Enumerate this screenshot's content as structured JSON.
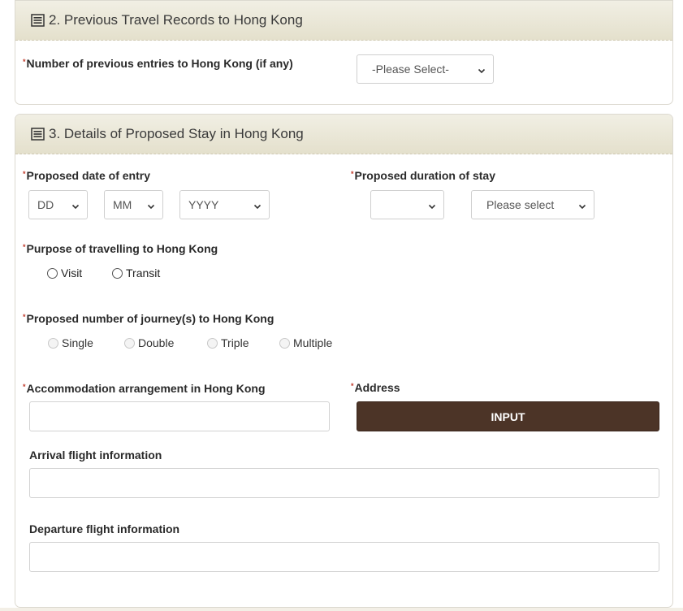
{
  "section2": {
    "title": "2. Previous Travel Records to Hong Kong",
    "entries_label": "Number of previous entries to Hong Kong (if any)",
    "entries_select": "-Please Select-"
  },
  "section3": {
    "title": "3. Details of Proposed Stay in Hong Kong",
    "entry_date_label": "Proposed date of entry",
    "day_select": "DD",
    "month_select": "MM",
    "year_select": "YYYY",
    "duration_label": "Proposed duration of stay",
    "duration_number_select": "",
    "duration_unit_select": "Please select",
    "purpose_label": "Purpose of travelling to Hong Kong",
    "purpose_options": [
      "Visit",
      "Transit"
    ],
    "journeys_label": "Proposed number of journey(s) to Hong Kong",
    "journey_options": [
      "Single",
      "Double",
      "Triple",
      "Multiple"
    ],
    "accommodation_label": "Accommodation arrangement in Hong Kong",
    "accommodation_value": "",
    "address_label": "Address",
    "address_button": "INPUT",
    "arrival_label": "Arrival flight information",
    "arrival_value": "",
    "departure_label": "Departure flight information",
    "departure_value": ""
  },
  "required_marker": "*",
  "colors": {
    "header_bg": "#e9e6d6",
    "button_bg": "#4c3427",
    "required": "#c0392b"
  }
}
